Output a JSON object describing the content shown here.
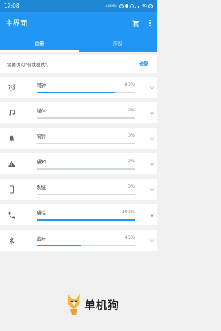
{
  "status": {
    "time": "17:08",
    "net_speed_value": "0.00KB/s",
    "net_speed_unit": "0.00KB/s",
    "network": "4G",
    "icons": [
      "nfc-icon",
      "mute-icon",
      "alarm-icon",
      "signal-icon",
      "battery-icon"
    ]
  },
  "app": {
    "title": "主界面",
    "actions": [
      "cart-icon",
      "more-icon"
    ]
  },
  "tabs": [
    {
      "label": "音量",
      "active": true
    },
    {
      "label": "预设",
      "active": false
    }
  ],
  "notice": {
    "text": "需要访问\"勿扰模式\"。",
    "action": "修复"
  },
  "rows": [
    {
      "label": "闹钟",
      "percent": "80%",
      "value": 80,
      "icon": "alarm-clock-icon"
    },
    {
      "label": "媒体",
      "percent": "0%",
      "value": 0,
      "icon": "music-note-icon"
    },
    {
      "label": "响铃",
      "percent": "0%",
      "value": 0,
      "icon": "bell-icon"
    },
    {
      "label": "通知",
      "percent": "0%",
      "value": 0,
      "icon": "warning-icon"
    },
    {
      "label": "系统",
      "percent": "0%",
      "value": 0,
      "icon": "phone-device-icon"
    },
    {
      "label": "通话",
      "percent": "100%",
      "value": 100,
      "icon": "phone-call-icon"
    },
    {
      "label": "蓝牙",
      "percent": "46%",
      "value": 46,
      "icon": "bluetooth-icon"
    }
  ],
  "watermark": {
    "text": "单机狗"
  },
  "colors": {
    "primary": "#2196f3",
    "status": "#1e88d6",
    "track": "#cfd8dc"
  }
}
